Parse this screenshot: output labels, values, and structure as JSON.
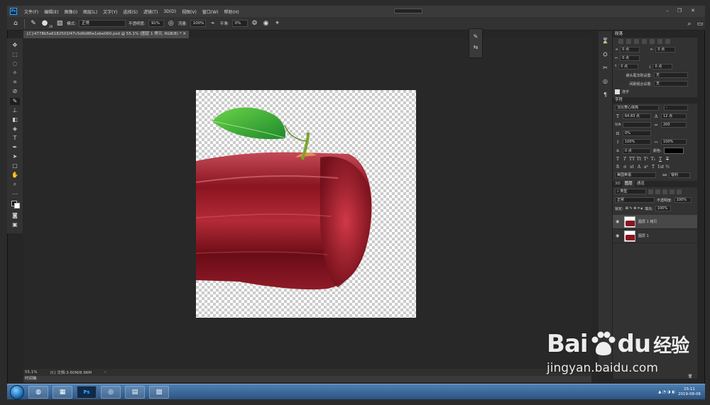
{
  "menubar": {
    "app_icon": "Ps",
    "items": [
      "文件(F)",
      "编辑(E)",
      "图像(I)",
      "图层(L)",
      "文字(Y)",
      "选择(S)",
      "滤镜(T)",
      "3D(D)",
      "视图(V)",
      "窗口(W)",
      "帮助(H)"
    ]
  },
  "options": {
    "mode_label": "模式:",
    "mode_value": "正常",
    "opacity_label": "不透明度:",
    "opacity_value": "91%",
    "flow_label": "流量:",
    "flow_value": "100%",
    "smooth_label": "平滑:",
    "smooth_value": "0%",
    "brush_size": "28"
  },
  "document": {
    "tab_title": "{C}4778b5a6182501f47c5d6d86e1ebe060.psd @ 55.1% (图层 1 拷贝, RGB/8) *"
  },
  "status": {
    "zoom": "55.1%",
    "doc_info": "(C) 文档:3.60M/8.96M",
    "timeline_label": "时间轴"
  },
  "paragraph_panel": {
    "title": "段落",
    "indent_left": "0 点",
    "indent_right": "0 点",
    "first_line": "0 点",
    "space_before": "0 点",
    "space_after": "0 点",
    "kinsoku_label": "避头尾法则设置:",
    "kinsoku_value": "无",
    "mojikumi_label": "间距组合设置:",
    "mojikumi_value": "无",
    "hyphenate_label": "连字"
  },
  "character_panel": {
    "title": "字符",
    "font_family": "汉仪菱心体简",
    "font_style": "-",
    "font_size": "64.83 点",
    "leading": "12 点",
    "kerning": "V/A",
    "tracking": "200",
    "vscale_pct": "0%",
    "vertical_scale": "100%",
    "horizontal_scale": "100%",
    "baseline": "0 点",
    "color_label": "颜色:",
    "text_color": "#000000",
    "language": "美国英语",
    "antialias": "锐利"
  },
  "layers_panel": {
    "tabs": [
      "3D",
      "图层",
      "通道"
    ],
    "filter_label": "类型",
    "blend_mode": "正常",
    "opacity_label": "不透明度:",
    "opacity_value": "100%",
    "lock_label": "锁定:",
    "fill_label": "填充:",
    "fill_value": "100%",
    "layers": [
      {
        "name": "图层 1 拷贝",
        "selected": true
      },
      {
        "name": "图层 1",
        "selected": false
      }
    ]
  },
  "taskbar": {
    "time": "15:11",
    "date": "2019-08-06"
  },
  "watermark": {
    "brand": "Bai",
    "brand_tail": "du",
    "experience": "经验",
    "url": "jingyan.baidu.com"
  },
  "colors": {
    "ui_dark": "#262626",
    "accent": "#31a8ff",
    "apple_red": "#8a1420"
  }
}
